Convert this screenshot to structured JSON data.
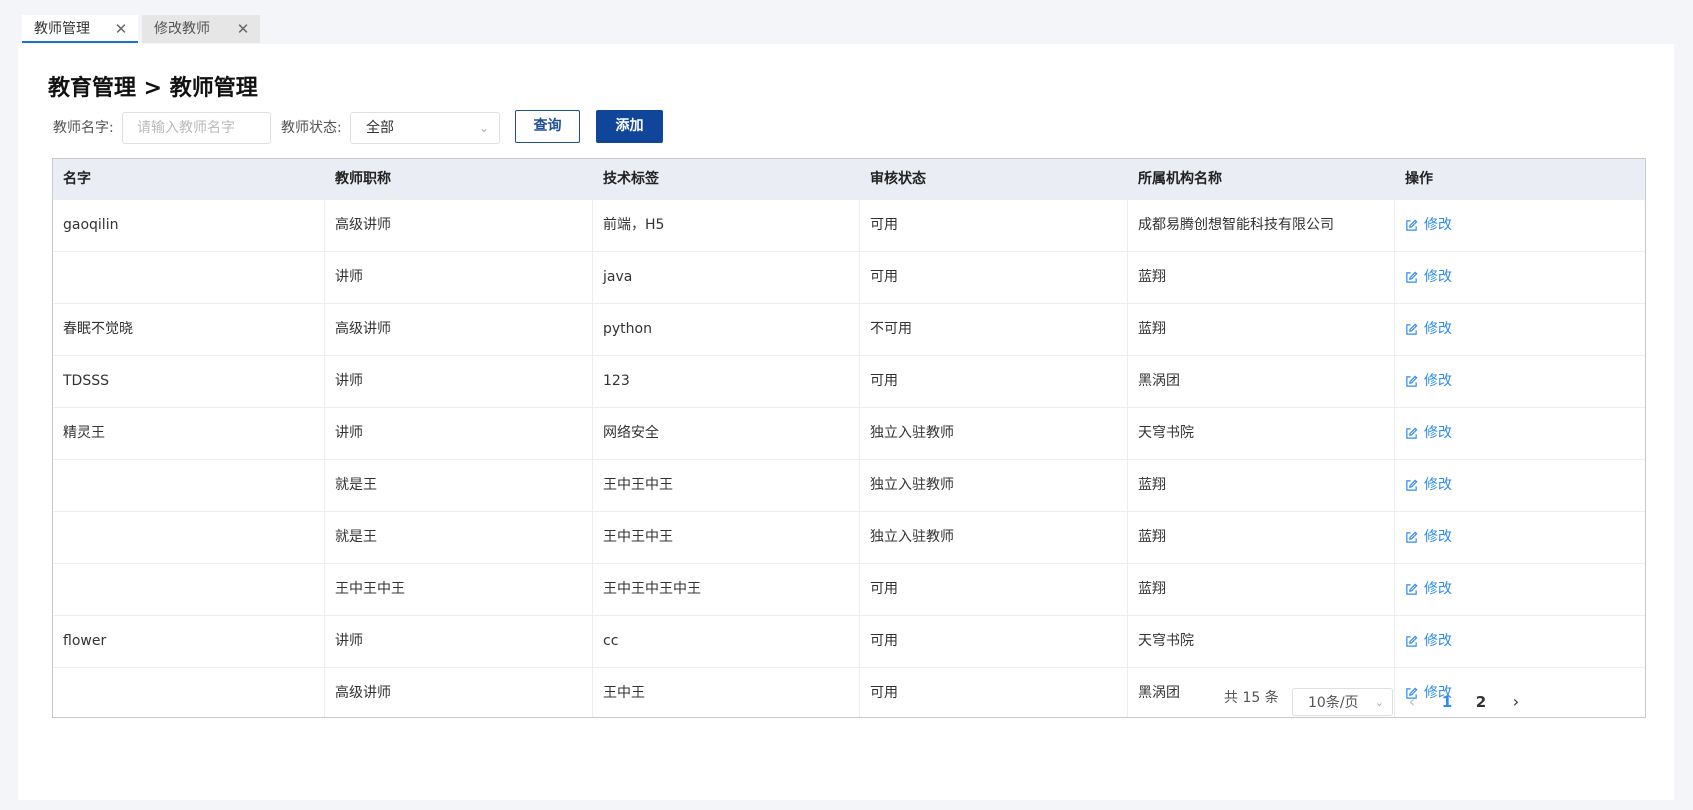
{
  "tabs": [
    {
      "label": "教师管理",
      "active": true
    },
    {
      "label": "修改教师",
      "active": false
    }
  ],
  "page_title": "教育管理 > 教师管理",
  "filters": {
    "name_label": "教师名字:",
    "name_placeholder": "请输入教师名字",
    "status_label": "教师状态:",
    "status_value": "全部",
    "query_label": "查询",
    "add_label": "添加"
  },
  "table": {
    "columns": [
      "名字",
      "教师职称",
      "技术标签",
      "审核状态",
      "所属机构名称",
      "操作"
    ],
    "rows": [
      {
        "name": "gaoqilin",
        "title": "高级讲师",
        "tags": "前端，H5",
        "status": "可用",
        "org": "成都易腾创想智能科技有限公司",
        "action": "修改"
      },
      {
        "name": "",
        "title": "讲师",
        "tags": "java",
        "status": "可用",
        "org": "蓝翔",
        "action": "修改"
      },
      {
        "name": "春眠不觉晓",
        "title": "高级讲师",
        "tags": "python",
        "status": "不可用",
        "org": "蓝翔",
        "action": "修改"
      },
      {
        "name": "TDSSS",
        "title": "讲师",
        "tags": "123",
        "status": "可用",
        "org": "黑涡团",
        "action": "修改"
      },
      {
        "name": "精灵王",
        "title": "讲师",
        "tags": "网络安全",
        "status": "独立入驻教师",
        "org": "天穹书院",
        "action": "修改"
      },
      {
        "name": "",
        "title": "就是王",
        "tags": "王中王中王",
        "status": "独立入驻教师",
        "org": "蓝翔",
        "action": "修改"
      },
      {
        "name": "",
        "title": "就是王",
        "tags": "王中王中王",
        "status": "独立入驻教师",
        "org": "蓝翔",
        "action": "修改"
      },
      {
        "name": "",
        "title": "王中王中王",
        "tags": "王中王中王中王",
        "status": "可用",
        "org": "蓝翔",
        "action": "修改"
      },
      {
        "name": "flower",
        "title": "讲师",
        "tags": "cc",
        "status": "可用",
        "org": "天穹书院",
        "action": "修改"
      },
      {
        "name": "",
        "title": "高级讲师",
        "tags": "王中王",
        "status": "可用",
        "org": "黑涡团",
        "action": "修改"
      }
    ]
  },
  "pagination": {
    "total_text": "共 15 条",
    "page_size": "10条/页",
    "pages": [
      "1",
      "2"
    ],
    "current_page": "1"
  },
  "colors": {
    "accent": "#10469a",
    "link": "#2d8cf0",
    "header_bg": "#ebedf4",
    "tab_active_underline": "#1f6fd1"
  },
  "icons": {
    "tab_close": "close-icon",
    "dropdown": "chevron-down-icon",
    "edit": "edit-icon",
    "prev": "chevron-left-icon",
    "next": "chevron-right-icon"
  }
}
